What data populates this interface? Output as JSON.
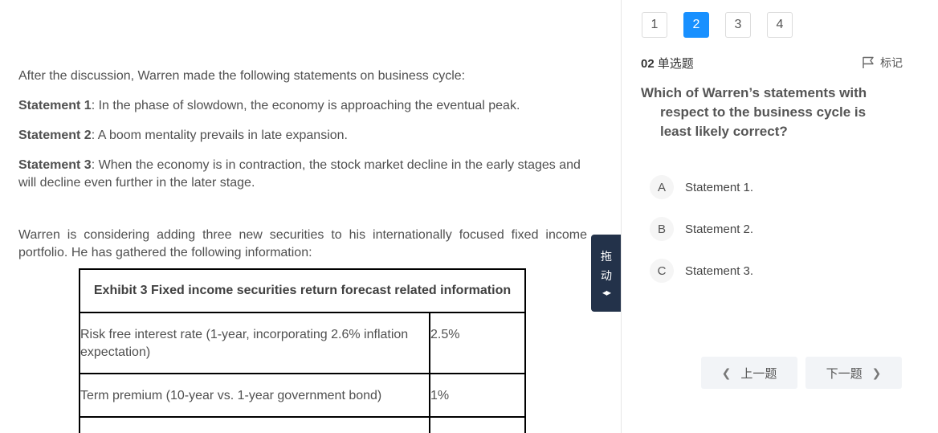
{
  "passage": {
    "intro": "After the discussion, Warren made the following statements on business cycle:",
    "statements": [
      {
        "label": "Statement 1",
        "text": ": In the phase of slowdown, the economy is approaching the eventual peak."
      },
      {
        "label": "Statement 2",
        "text": ": A boom mentality prevails in late expansion."
      },
      {
        "label": "Statement 3",
        "text": ": When the economy is in contraction, the stock market decline in the early stages and will decline even further in the later stage."
      }
    ],
    "portfolio_text": "Warren is considering adding three new securities to his internationally focused fixed income portfolio. He has gathered the following information:",
    "exhibit": {
      "title": "Exhibit 3 Fixed income securities return forecast related information",
      "rows": [
        {
          "label": "Risk free interest rate (1-year, incorporating 2.6% inflation expectation)",
          "value": "2.5%"
        },
        {
          "label": "Term premium (10-year vs. 1-year government bond)",
          "value": "1%"
        },
        {
          "label": "",
          "value": ""
        }
      ]
    }
  },
  "drag_handle": {
    "line1": "拖",
    "line2": "动",
    "arrows": "◂▸"
  },
  "question_nav": {
    "numbers": [
      "1",
      "2",
      "3",
      "4"
    ],
    "active": "2"
  },
  "question": {
    "number": "02",
    "type": "单选题",
    "mark_label": "标记",
    "text": "Which of Warren’s statements with respect to the business cycle is least likely correct?",
    "options": [
      {
        "letter": "A",
        "text": "Statement 1."
      },
      {
        "letter": "B",
        "text": "Statement 2."
      },
      {
        "letter": "C",
        "text": "Statement 3."
      }
    ]
  },
  "nav": {
    "prev": "上一题",
    "next": "下一题"
  }
}
